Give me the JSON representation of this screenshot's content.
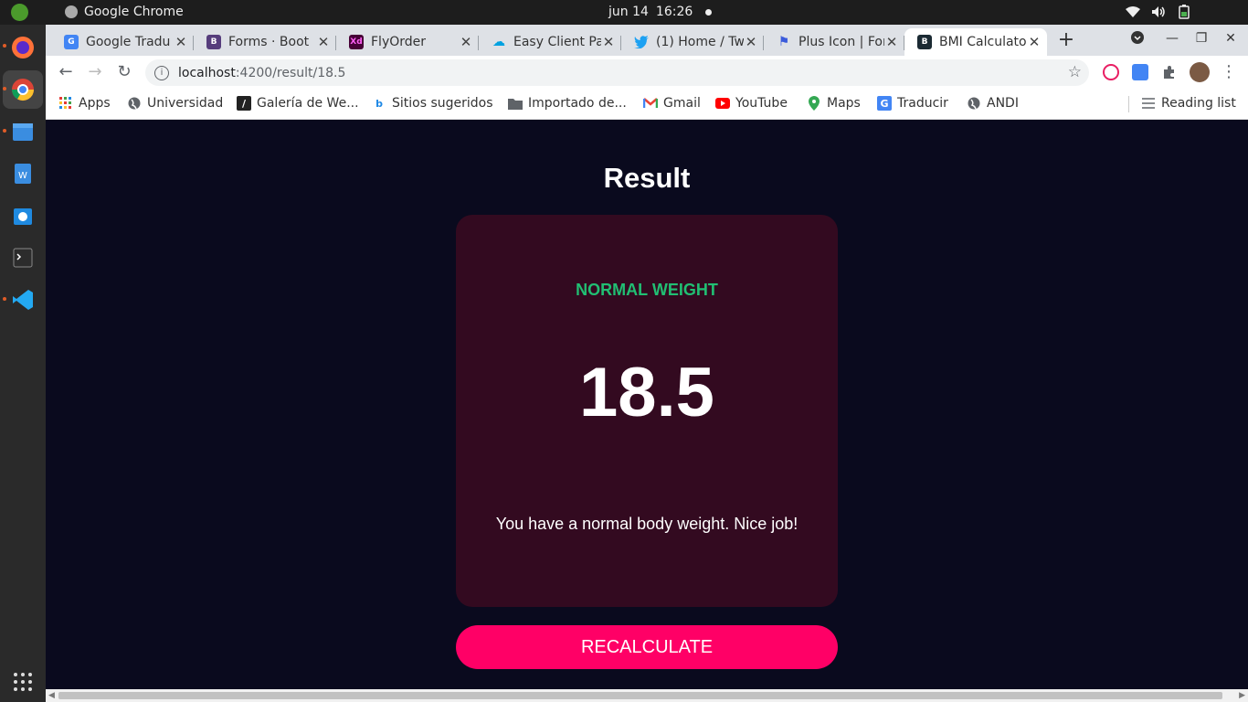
{
  "system": {
    "app_name": "Google Chrome",
    "date": "jun 14",
    "time": "16:26"
  },
  "tabs": [
    {
      "title": "Google Tradu",
      "favicon_color": "#4285f4",
      "favicon_text": "G"
    },
    {
      "title": "Forms · Boot",
      "favicon_color": "#563d7c",
      "favicon_text": "B"
    },
    {
      "title": "FlyOrder",
      "favicon_color": "#470137",
      "favicon_text": "Xd"
    },
    {
      "title": "Easy Client Pa",
      "favicon_color": "#00a1e0",
      "favicon_text": "☁"
    },
    {
      "title": "(1) Home / Tw",
      "favicon_color": "#1da1f2",
      "favicon_text": "t"
    },
    {
      "title": "Plus Icon | For",
      "favicon_color": "#3b5bdb",
      "favicon_text": "⚑"
    },
    {
      "title": "BMI Calculato",
      "favicon_color": "#1b2a33",
      "favicon_text": "B",
      "active": true
    }
  ],
  "address_bar": {
    "host": "localhost",
    "path": ":4200/result/18.5"
  },
  "bookmarks": [
    {
      "label": "Apps",
      "icon": "apps-grid-icon"
    },
    {
      "label": "Universidad",
      "icon": "globe-icon"
    },
    {
      "label": "Galería de We...",
      "icon": "bookmark-logo-icon"
    },
    {
      "label": "Sitios sugeridos",
      "icon": "bing-icon"
    },
    {
      "label": "Importado de...",
      "icon": "folder-icon"
    },
    {
      "label": "Gmail",
      "icon": "gmail-icon"
    },
    {
      "label": "YouTube",
      "icon": "youtube-icon"
    },
    {
      "label": "Maps",
      "icon": "maps-pin-icon"
    },
    {
      "label": "Traducir",
      "icon": "translate-icon"
    },
    {
      "label": "ANDI",
      "icon": "globe-icon"
    }
  ],
  "reading_list": "Reading list",
  "page": {
    "title": "Result",
    "category": "NORMAL WEIGHT",
    "bmi_value": "18.5",
    "message": "You have a normal body weight. Nice job!",
    "button_label": "RECALCULATE"
  },
  "colors": {
    "background": "#0a0a1e",
    "card": "#330a20",
    "category": "#21bf73",
    "button": "#ff0066"
  }
}
